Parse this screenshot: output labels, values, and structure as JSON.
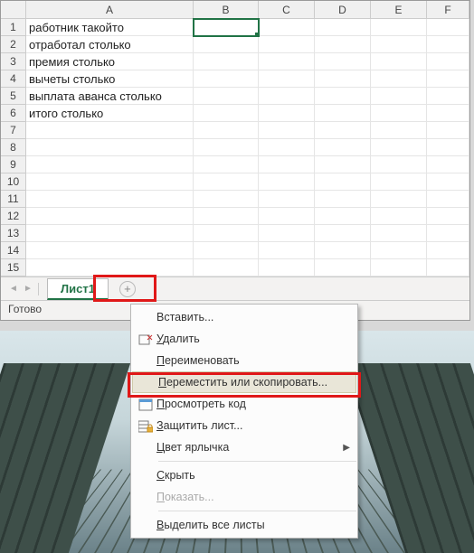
{
  "columns": [
    "A",
    "B",
    "C",
    "D",
    "E",
    "F"
  ],
  "rowCount": 15,
  "cells": {
    "A1": "работник такойто",
    "A2": "отработал столько",
    "A3": "премия столько",
    "A4": "вычеты столько",
    "A5": "выплата аванса столько",
    "A6": "итого столько"
  },
  "activeCell": "B1",
  "sheet": {
    "tab_label": "Лист1"
  },
  "status": {
    "text": "Готово"
  },
  "menu": {
    "insert": "Вставить...",
    "delete": "Удалить",
    "rename": "Переименовать",
    "move": "Переместить или скопировать...",
    "viewcode": "Просмотреть код",
    "protect": "Защитить лист...",
    "tabcolor": "Цвет ярлычка",
    "hide": "Скрыть",
    "unhide": "Показать...",
    "selectall": "Выделить все листы"
  },
  "underline": {
    "delete_u": "У",
    "rename_u": "П",
    "move_u": "П",
    "viewcode_u": "П",
    "protect_u": "З",
    "tabcolor_u": "Ц",
    "hide_u": "С",
    "unhide_u": "П",
    "selectall_u": "В"
  },
  "chart_data": {
    "type": "table",
    "columns": [
      "A",
      "B",
      "C",
      "D",
      "E",
      "F"
    ],
    "rows": [
      {
        "row": 1,
        "A": "работник такойто"
      },
      {
        "row": 2,
        "A": "отработал столько"
      },
      {
        "row": 3,
        "A": "премия столько"
      },
      {
        "row": 4,
        "A": "вычеты столько"
      },
      {
        "row": 5,
        "A": "выплата аванса столько"
      },
      {
        "row": 6,
        "A": "итого столько"
      }
    ]
  }
}
